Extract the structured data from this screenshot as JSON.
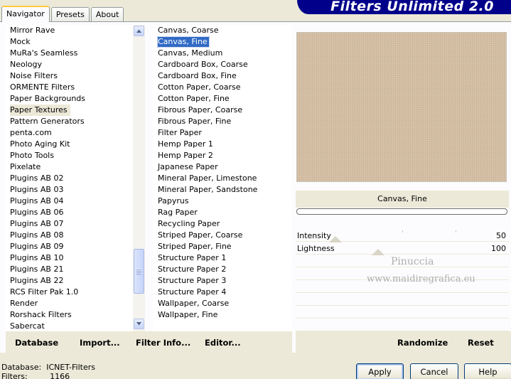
{
  "tabs": [
    "Navigator",
    "Presets",
    "About"
  ],
  "banner_title": "Filters Unlimited 2.0",
  "categories": [
    "Mirror Rave",
    "Mock",
    "MuRa's Seamless",
    "Neology",
    "Noise Filters",
    "ORMENTE Filters",
    "Paper Backgrounds",
    "Paper Textures",
    "Pattern Generators",
    "penta.com",
    "Photo Aging Kit",
    "Photo Tools",
    "Pixelate",
    "Plugins AB 02",
    "Plugins AB 03",
    "Plugins AB 04",
    "Plugins AB 06",
    "Plugins AB 07",
    "Plugins AB 08",
    "Plugins AB 09",
    "Plugins AB 10",
    "Plugins AB 21",
    "Plugins AB 22",
    "RCS Filter Pak 1.0",
    "Render",
    "Rorshack Filters",
    "Sabercat"
  ],
  "selected_category": "Paper Textures",
  "filters": [
    "Canvas, Coarse",
    "Canvas, Fine",
    "Canvas, Medium",
    "Cardboard Box, Coarse",
    "Cardboard Box, Fine",
    "Cotton Paper, Coarse",
    "Cotton Paper, Fine",
    "Fibrous Paper, Coarse",
    "Fibrous Paper, Fine",
    "Filter Paper",
    "Hemp Paper 1",
    "Hemp Paper 2",
    "Japanese Paper",
    "Mineral Paper, Limestone",
    "Mineral Paper, Sandstone",
    "Papyrus",
    "Rag Paper",
    "Recycling Paper",
    "Striped Paper, Coarse",
    "Striped Paper, Fine",
    "Structure Paper 1",
    "Structure Paper 2",
    "Structure Paper 3",
    "Structure Paper 4",
    "Wallpaper, Coarse",
    "Wallpaper, Fine"
  ],
  "selected_filter": "Canvas, Fine",
  "bottom_left": {
    "database": "Database",
    "import": "Import...",
    "filter_info": "Filter Info...",
    "editor": "Editor..."
  },
  "bottom_right": {
    "randomize": "Randomize",
    "reset": "Reset"
  },
  "current_filter_name": "Canvas, Fine",
  "params": {
    "intensity": {
      "label": "Intensity",
      "value": "50",
      "level": 50
    },
    "lightness": {
      "label": "Lightness",
      "value": "100",
      "level": 100
    }
  },
  "watermark": {
    "line1": "Pinuccia",
    "line2": "www.maidiregrafica.eu"
  },
  "status": {
    "database_label": "Database:",
    "database_value": "ICNET-Filters",
    "filters_label": "Filters:",
    "filters_value": "1166"
  },
  "dialog_buttons": {
    "apply": "Apply",
    "cancel": "Cancel",
    "help": "Help"
  },
  "colors": {
    "banner": "#00008a",
    "selection": "#316ac5",
    "preview_texture": "#d4bea4",
    "panel": "#ece9d8"
  }
}
